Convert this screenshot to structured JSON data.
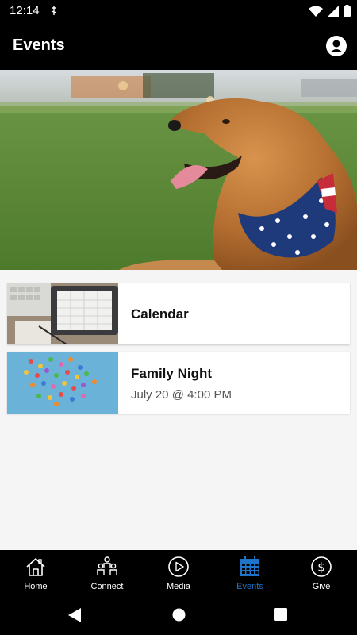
{
  "status_bar": {
    "time": "12:14"
  },
  "header": {
    "title": "Events"
  },
  "events": [
    {
      "title": "Calendar",
      "subtitle": ""
    },
    {
      "title": "Family Night",
      "subtitle": "July 20 @ 4:00 PM"
    }
  ],
  "nav": {
    "items": [
      {
        "label": "Home",
        "icon": "home-icon"
      },
      {
        "label": "Connect",
        "icon": "people-icon"
      },
      {
        "label": "Media",
        "icon": "play-circle-icon"
      },
      {
        "label": "Events",
        "icon": "calendar-icon",
        "active": true
      },
      {
        "label": "Give",
        "icon": "dollar-circle-icon"
      }
    ]
  },
  "colors": {
    "accent": "#1e74c8",
    "bar_background": "#000000",
    "content_background": "#f5f5f5"
  }
}
